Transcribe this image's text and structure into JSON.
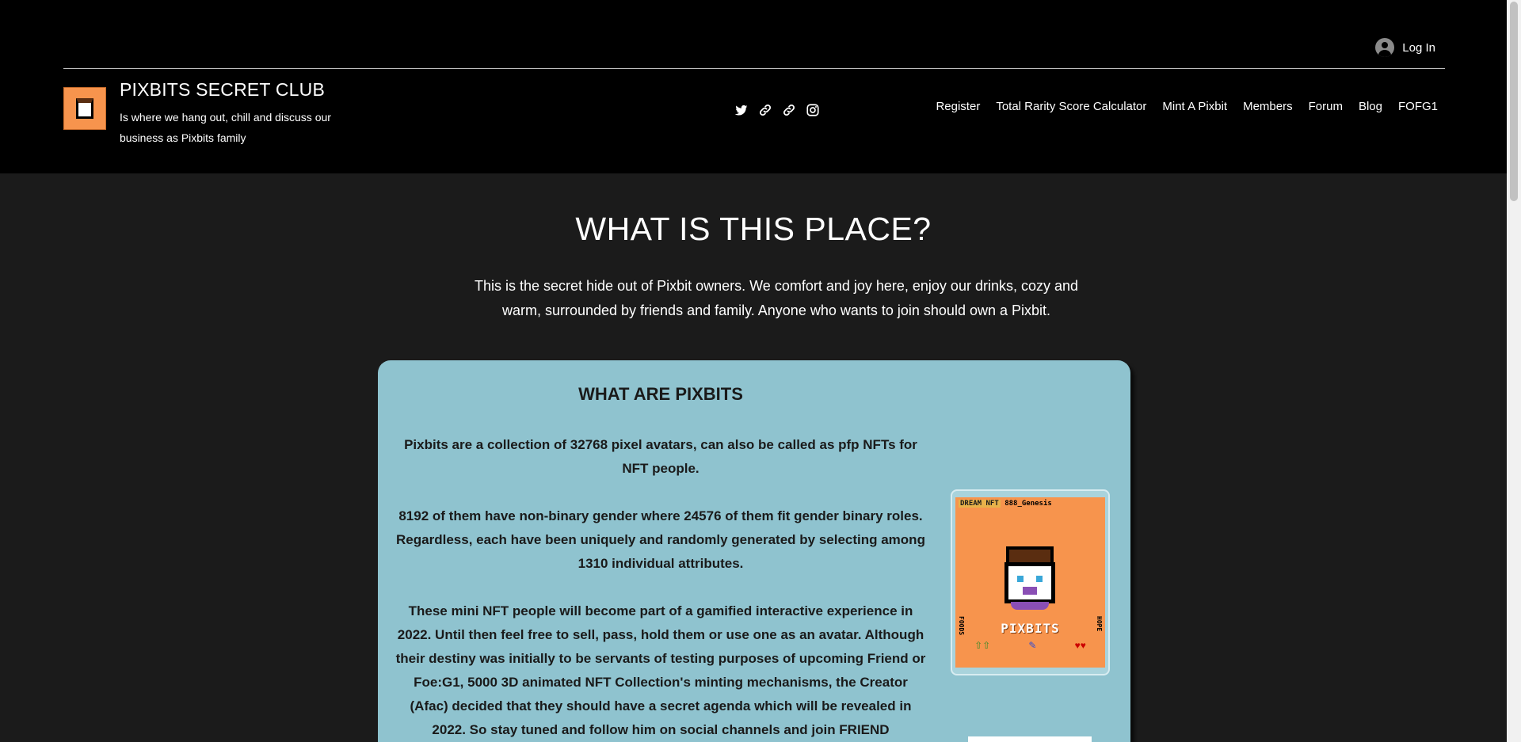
{
  "header": {
    "login_label": "Log In",
    "site_title": "PIXBITS SECRET CLUB",
    "tagline": "Is where we hang out, chill and discuss our business as Pixbits family",
    "social_icons": [
      "twitter-icon",
      "link-icon",
      "link-icon",
      "instagram-icon"
    ],
    "nav": [
      "Register",
      "Total Rarity Score Calculator",
      "Mint A Pixbit",
      "Members",
      "Forum",
      "Blog",
      "FOFG1"
    ]
  },
  "main": {
    "title": "WHAT IS THIS PLACE?",
    "intro": "This is the secret hide out of Pixbit owners. We comfort and joy here, enjoy our drinks, cozy and warm, surrounded by friends and family. Anyone who wants to join should own a Pixbit."
  },
  "card": {
    "title": "WHAT ARE PIXBITS",
    "paragraphs": [
      "Pixbits are a collection of 32768 pixel avatars, can also be called as pfp NFTs for NFT people.",
      "8192 of them have non-binary gender where 24576 of them fit gender binary roles. Regardless, each have been uniquely and randomly generated by selecting among 1310 individual attributes.",
      "These mini NFT people will become part of a gamified interactive experience in 2022. Until then feel free to sell, pass, hold them or use one as an avatar. Although their destiny was initially to be servants of testing purposes of upcoming Friend or Foe:G1, 5000 3D animated NFT Collection's minting mechanisms, the Creator (Afac) decided that they should have a secret agenda which will be revealed in 2022. So stay tuned and follow him on social channels and join FRIEND"
    ],
    "nft": {
      "top_left": "DREAM NFT",
      "top_right": "888_Genesis",
      "label": "PIXBITS",
      "side_left": "FOODS",
      "side_right": "HOPE",
      "bottom_left": "⇧⇧",
      "bottom_mid": "✎",
      "bottom_right": "♥♥"
    }
  },
  "colors": {
    "header_bg": "#000000",
    "page_bg": "#1b1b1b",
    "card_bg": "#8fc3cf",
    "nft_bg": "#f7944d"
  }
}
